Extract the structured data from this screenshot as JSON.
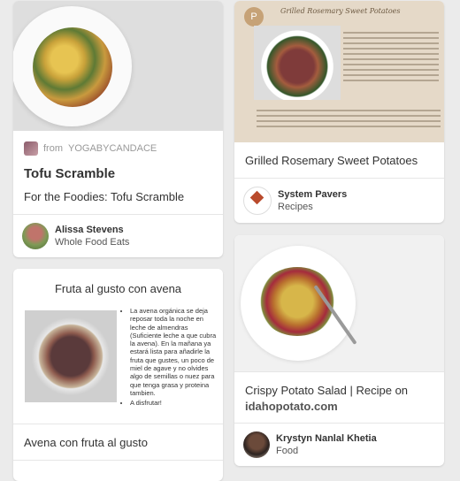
{
  "cards": {
    "tofu": {
      "source_prefix": "from",
      "source_name": "YOGABYCANDACE",
      "title": "Tofu Scramble",
      "description": "For the Foodies: Tofu Scramble",
      "user_name": "Alissa Stevens",
      "board": "Whole Food Eats"
    },
    "sweet_potatoes": {
      "image_title": "Grilled Rosemary Sweet Potatoes",
      "title": "Grilled Rosemary Sweet Potatoes",
      "user_name": "System Pavers",
      "board": "Recipes"
    },
    "avena": {
      "image_title": "Fruta al gusto con avena",
      "bullets": [
        "La avena orgánica se deja reposar toda la noche en leche de almendras (Suficiente leche a que cubra la avena). En la mañana ya estará lista para añadirle la fruta que gustes, un poco de miel de agave y no olvides algo de semillas o nuez para que tenga grasa y proteina tambien.",
        "A disfrutar!"
      ],
      "title": "Avena con fruta al gusto"
    },
    "potato_salad": {
      "title": "Crispy Potato Salad | Recipe on",
      "domain": "idahopotato.com",
      "user_name": "Krystyn Nanlal Khetia",
      "board": "Food"
    }
  },
  "colors": {
    "background": "#ebebeb",
    "card": "#ffffff",
    "text": "#333333",
    "muted": "#999999"
  }
}
